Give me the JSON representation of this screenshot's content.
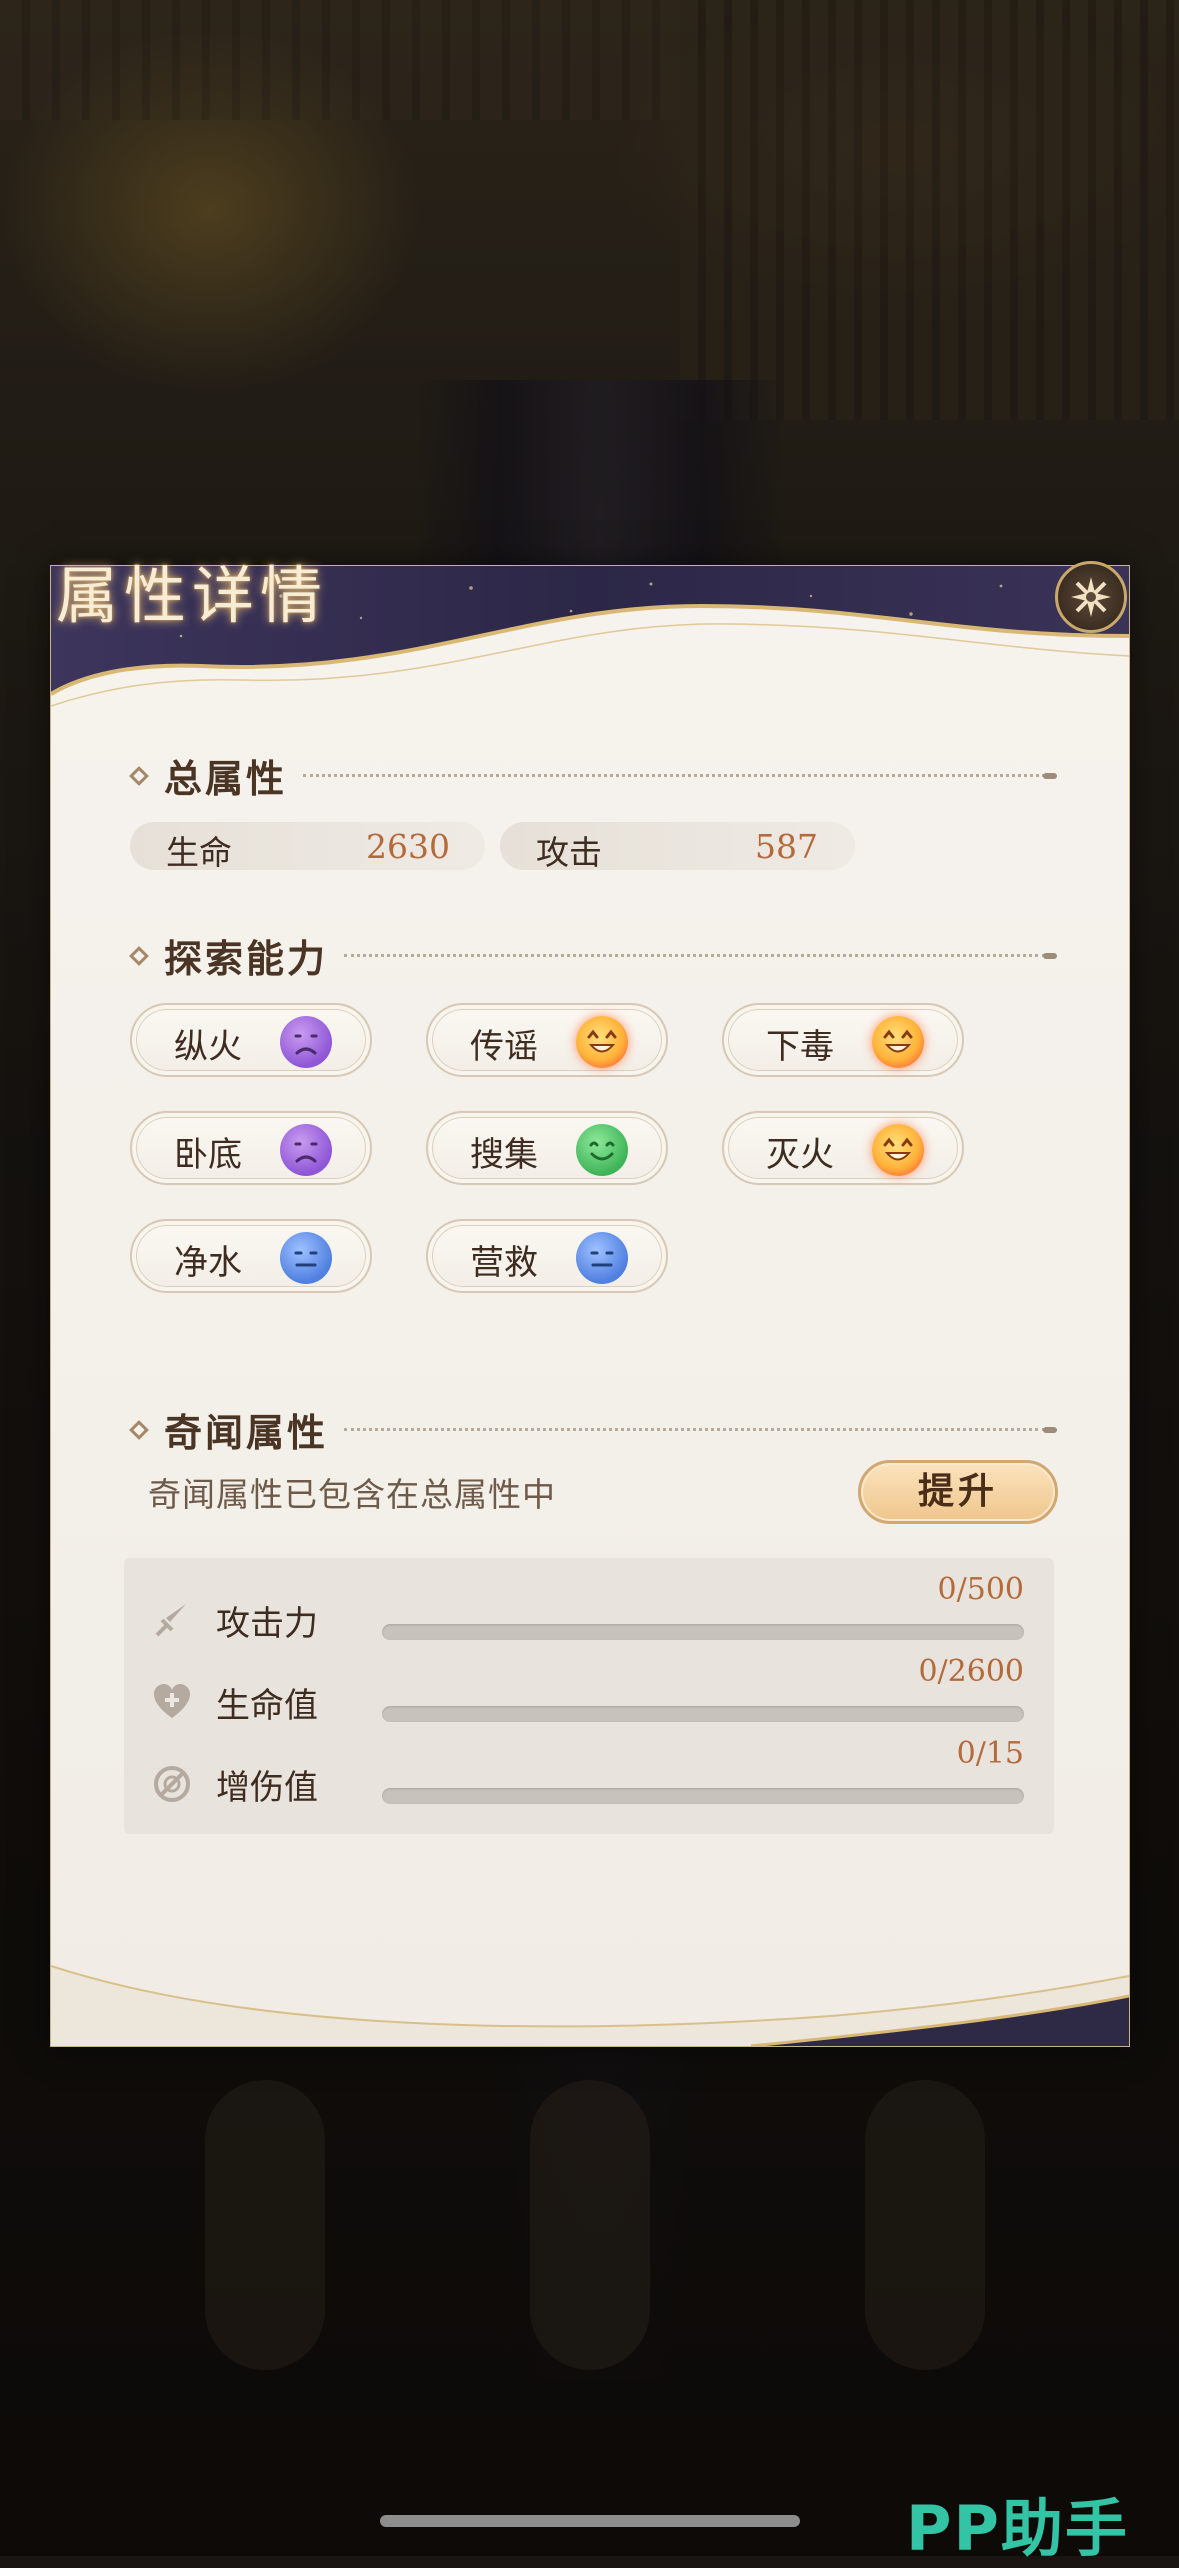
{
  "panel": {
    "title": "属性详情"
  },
  "total": {
    "heading": "总属性",
    "stats": [
      {
        "key": "生命",
        "value": "2630"
      },
      {
        "key": "攻击",
        "value": "587"
      }
    ]
  },
  "explore": {
    "heading": "探索能力",
    "items": [
      {
        "name": "纵火",
        "mood": "sad"
      },
      {
        "name": "传谣",
        "mood": "happy"
      },
      {
        "name": "下毒",
        "mood": "happy"
      },
      {
        "name": "卧底",
        "mood": "sad"
      },
      {
        "name": "搜集",
        "mood": "smile"
      },
      {
        "name": "灭火",
        "mood": "happy"
      },
      {
        "name": "净水",
        "mood": "neutral"
      },
      {
        "name": "营救",
        "mood": "neutral"
      }
    ]
  },
  "curio": {
    "heading": "奇闻属性",
    "note": "奇闻属性已包含在总属性中",
    "upgrade_label": "提升",
    "rows": [
      {
        "label": "攻击力",
        "value": "0/500",
        "progress": 0,
        "icon": "sword-icon"
      },
      {
        "label": "生命值",
        "value": "0/2600",
        "progress": 0,
        "icon": "heart-plus-icon"
      },
      {
        "label": "增伤值",
        "value": "0/15",
        "progress": 0,
        "icon": "damage-boost-icon"
      }
    ]
  },
  "watermark": "PP助手",
  "colors": {
    "accent_value": "#b46a3a",
    "upgrade_button": "#efc68c",
    "watermark": "#32c4a4"
  }
}
